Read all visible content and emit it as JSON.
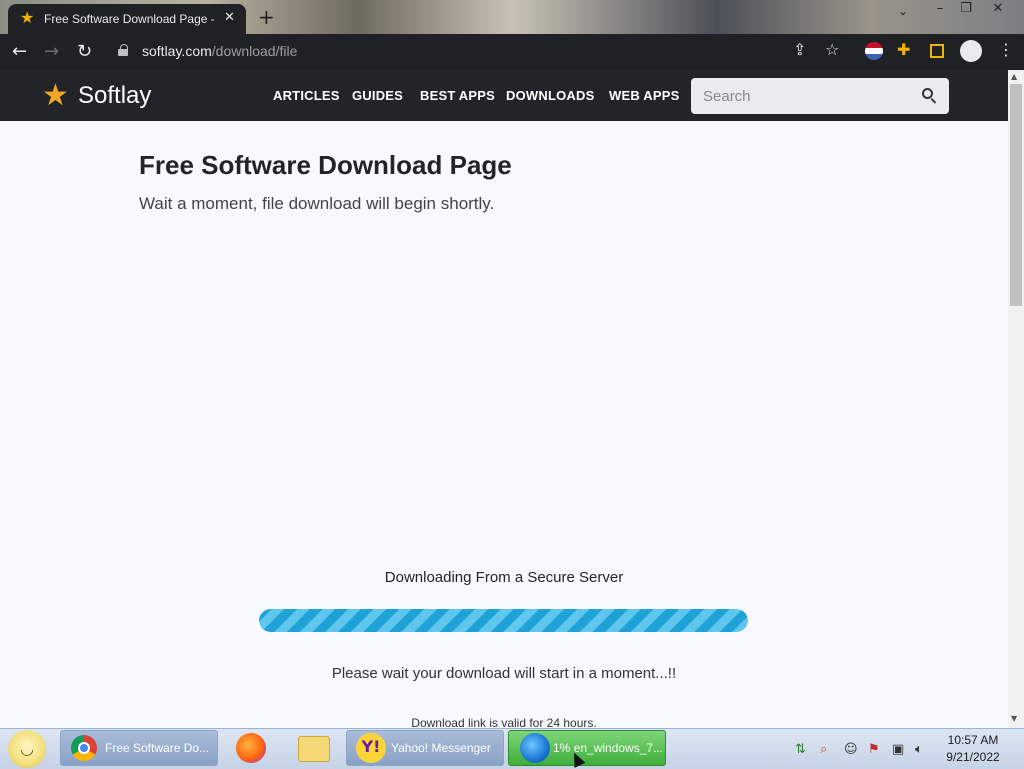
{
  "browser": {
    "tab_title": "Free Software Download Page -  ",
    "url_host": "softlay.com",
    "url_path": "/download/file"
  },
  "site": {
    "logo": "Softlay",
    "nav": [
      "ARTICLES",
      "GUIDES",
      "BEST APPS",
      "DOWNLOADS",
      "WEB APPS"
    ],
    "search_placeholder": "Search"
  },
  "page": {
    "title": "Free Software Download Page",
    "subtitle": "Wait a moment, file download will begin shortly.",
    "downloading_label": "Downloading From a Secure Server",
    "progress_fraction": 1.0,
    "wait_message": "Please wait your download will start in a moment...!!",
    "valid_message": "Download link is valid for 24 hours."
  },
  "taskbar": {
    "tasks": [
      {
        "label": "Free Software Do..."
      },
      {
        "label": "Yahoo! Messenger"
      },
      {
        "label": "1% en_windows_7..."
      }
    ],
    "clock_time": "10:57 AM",
    "clock_date": "9/21/2022"
  },
  "colors": {
    "site_header": "#212529",
    "accent_star": "#f5a623",
    "progress": "#1fa3d6"
  }
}
